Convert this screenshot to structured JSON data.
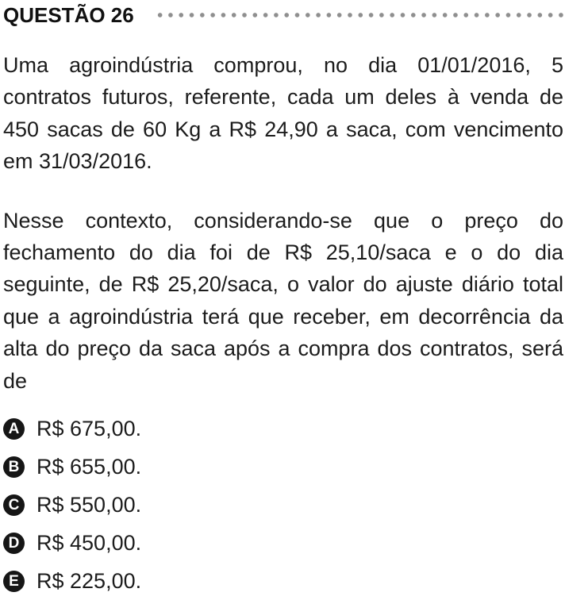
{
  "question": {
    "title": "QUESTÃO 26",
    "paragraphs": [
      "Uma agroindústria comprou, no dia 01/01/2016, 5 contratos futuros, referente, cada um deles à venda de 450 sacas de 60 Kg a R$ 24,90 a saca, com vencimento em 31/03/2016.",
      "Nesse contexto, considerando-se que o preço do fechamento do dia foi de R$ 25,10/saca e o do dia seguinte, de R$ 25,20/saca, o valor do ajuste diário total que a agroindústria terá que receber, em decorrência da alta do preço da saca após a compra dos contratos, será de"
    ],
    "options": [
      {
        "letter": "A",
        "text": "R$ 675,00."
      },
      {
        "letter": "B",
        "text": "R$ 655,00."
      },
      {
        "letter": "C",
        "text": "R$ 550,00."
      },
      {
        "letter": "D",
        "text": "R$ 450,00."
      },
      {
        "letter": "E",
        "text": "R$ 225,00."
      }
    ]
  }
}
